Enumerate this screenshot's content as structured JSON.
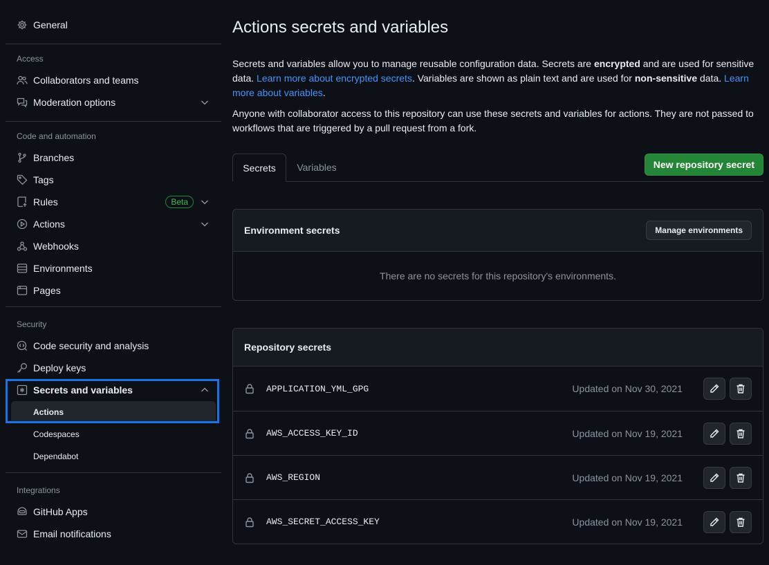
{
  "sidebar": {
    "general": "General",
    "groups": {
      "access": "Access",
      "code_automation": "Code and automation",
      "security": "Security",
      "integrations": "Integrations"
    },
    "items": {
      "collaborators": "Collaborators and teams",
      "moderation": "Moderation options",
      "branches": "Branches",
      "tags": "Tags",
      "rules": "Rules",
      "rules_badge": "Beta",
      "actions": "Actions",
      "webhooks": "Webhooks",
      "environments": "Environments",
      "pages": "Pages",
      "code_security": "Code security and analysis",
      "deploy_keys": "Deploy keys",
      "secrets_variables": "Secrets and variables",
      "sub_actions": "Actions",
      "sub_codespaces": "Codespaces",
      "sub_dependabot": "Dependabot",
      "github_apps": "GitHub Apps",
      "email_notifications": "Email notifications"
    }
  },
  "main": {
    "title": "Actions secrets and variables",
    "intro": {
      "p1_a": "Secrets and variables allow you to manage reusable configuration data. Secrets are ",
      "p1_b": "encrypted",
      "p1_c": " and are used for sensitive data. ",
      "p1_link1": "Learn more about encrypted secrets",
      "p1_d": ". Variables are shown as plain text and are used for ",
      "p1_e": "non-sensitive",
      "p1_f": " data. ",
      "p1_link2": "Learn more about variables",
      "p1_g": ".",
      "p2": "Anyone with collaborator access to this repository can use these secrets and variables for actions. They are not passed to workflows that are triggered by a pull request from a fork."
    },
    "tabs": {
      "secrets": "Secrets",
      "variables": "Variables"
    },
    "new_secret_button": "New repository secret",
    "env_secrets": {
      "title": "Environment secrets",
      "manage_button": "Manage environments",
      "empty": "There are no secrets for this repository's environments."
    },
    "repo_secrets": {
      "title": "Repository secrets",
      "rows": [
        {
          "name": "APPLICATION_YML_GPG",
          "updated": "Updated on Nov 30, 2021"
        },
        {
          "name": "AWS_ACCESS_KEY_ID",
          "updated": "Updated on Nov 19, 2021"
        },
        {
          "name": "AWS_REGION",
          "updated": "Updated on Nov 19, 2021"
        },
        {
          "name": "AWS_SECRET_ACCESS_KEY",
          "updated": "Updated on Nov 19, 2021"
        }
      ]
    }
  },
  "colors": {
    "background": "#0d1117",
    "primary_button": "#238636",
    "link": "#4493f8",
    "highlight": "#1a73e8"
  }
}
